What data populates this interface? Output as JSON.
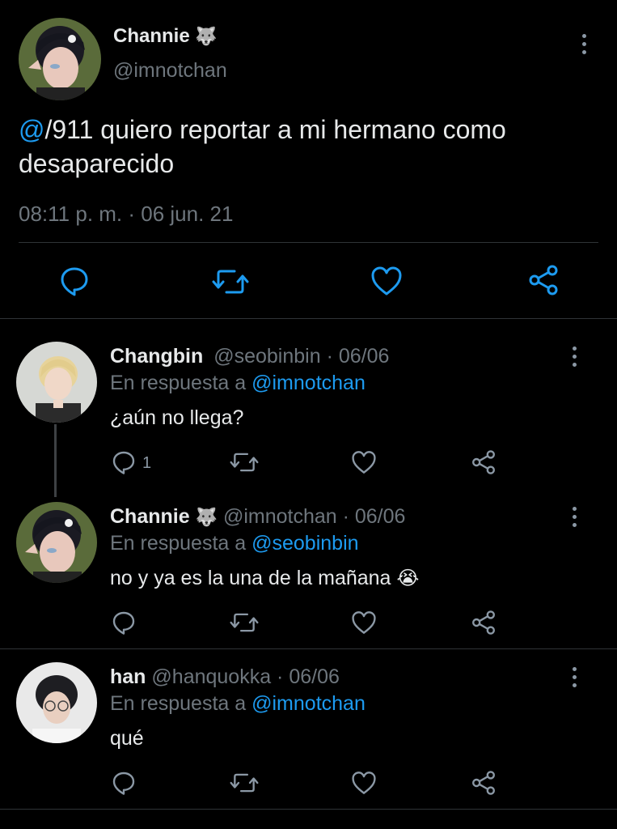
{
  "main_tweet": {
    "display_name": "Channie",
    "name_emoji": "🐺",
    "handle": "@imnotchan",
    "mention": "@",
    "text_after_mention": "/911 quiero reportar a mi hermano como",
    "text_line2": "desaparecido",
    "timestamp": "08:11 p. m. · 06 jun. 21"
  },
  "replies": [
    {
      "display_name": "Changbin",
      "handle_date": "@seobinbin · 06/06",
      "reply_prefix": "En respuesta a",
      "reply_to": "@imnotchan",
      "text": "¿aún no llega?",
      "reply_count": "1"
    },
    {
      "display_name": "Channie",
      "name_emoji": "🐺",
      "handle_date": "@imnotchan · 06/06",
      "reply_prefix": "En respuesta a",
      "reply_to": "@seobinbin",
      "text": "no y ya es la una de la mañana",
      "text_emoji": "😭"
    },
    {
      "display_name": "han",
      "handle_date": "@hanquokka · 06/06",
      "reply_prefix": "En respuesta a",
      "reply_to": "@imnotchan",
      "text": "qué"
    }
  ],
  "colors": {
    "background": "#000000",
    "text": "#e7e9ea",
    "muted": "#6e767d",
    "link": "#1d9bf0",
    "divider": "#2f3336"
  },
  "icons": [
    "reply-icon",
    "retweet-icon",
    "like-icon",
    "share-icon",
    "more-options-icon"
  ]
}
